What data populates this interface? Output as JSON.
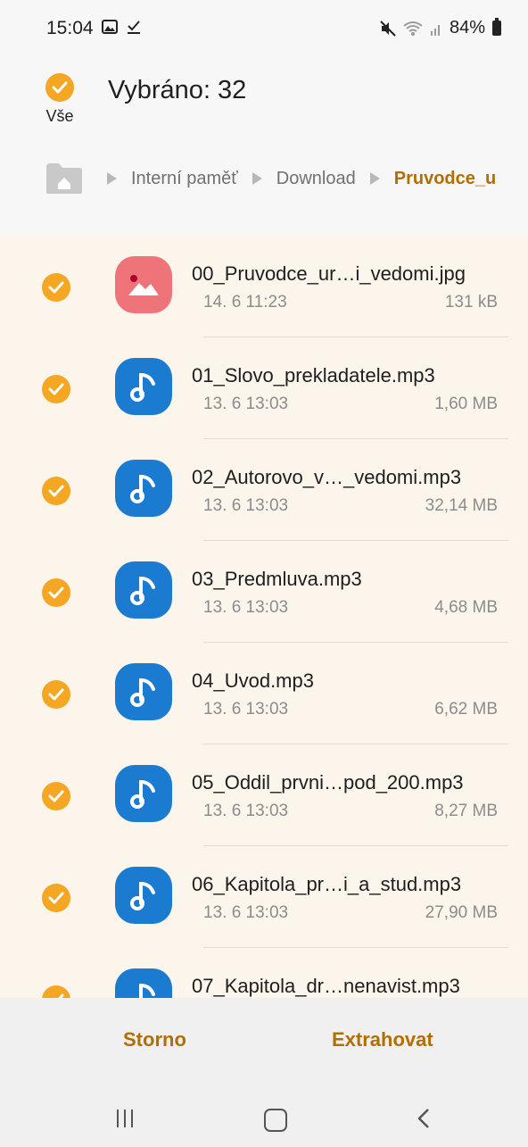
{
  "status_bar": {
    "time": "15:04",
    "battery": "84%",
    "left_icons": [
      "image-notification-icon",
      "download-done-icon"
    ],
    "right_icons": [
      "mute-icon",
      "wifi-icon",
      "signal-icon",
      "battery-icon"
    ]
  },
  "header": {
    "select_all_label": "Vše",
    "title": "Vybráno: 32"
  },
  "breadcrumb": {
    "items": [
      "Interní paměť",
      "Download",
      "Pruvodce_u"
    ]
  },
  "files": [
    {
      "name": "00_Pruvodce_ur…i_vedomi.jpg",
      "date": "14. 6 11:23",
      "size": "131 kB",
      "type": "image",
      "checked": true
    },
    {
      "name": "01_Slovo_prekladatele.mp3",
      "date": "13. 6 13:03",
      "size": "1,60 MB",
      "type": "audio",
      "checked": true
    },
    {
      "name": "02_Autorovo_v…_vedomi.mp3",
      "date": "13. 6 13:03",
      "size": "32,14 MB",
      "type": "audio",
      "checked": true
    },
    {
      "name": "03_Predmluva.mp3",
      "date": "13. 6 13:03",
      "size": "4,68 MB",
      "type": "audio",
      "checked": true
    },
    {
      "name": "04_Uvod.mp3",
      "date": "13. 6 13:03",
      "size": "6,62 MB",
      "type": "audio",
      "checked": true
    },
    {
      "name": "05_Oddil_prvni…pod_200.mp3",
      "date": "13. 6 13:03",
      "size": "8,27 MB",
      "type": "audio",
      "checked": true
    },
    {
      "name": "06_Kapitola_pr…i_a_stud.mp3",
      "date": "13. 6 13:03",
      "size": "27,90 MB",
      "type": "audio",
      "checked": true
    },
    {
      "name": "07_Kapitola_dr…nenavist.mp3",
      "date": "",
      "size": "",
      "type": "audio",
      "checked": true
    }
  ],
  "actions": {
    "cancel_label": "Storno",
    "extract_label": "Extrahovat"
  },
  "colors": {
    "accent": "#f5a623",
    "accent_text": "#b06f00",
    "audio_icon": "#1a7bd1",
    "image_icon": "#ee7479",
    "list_background": "#fbf5ec"
  }
}
